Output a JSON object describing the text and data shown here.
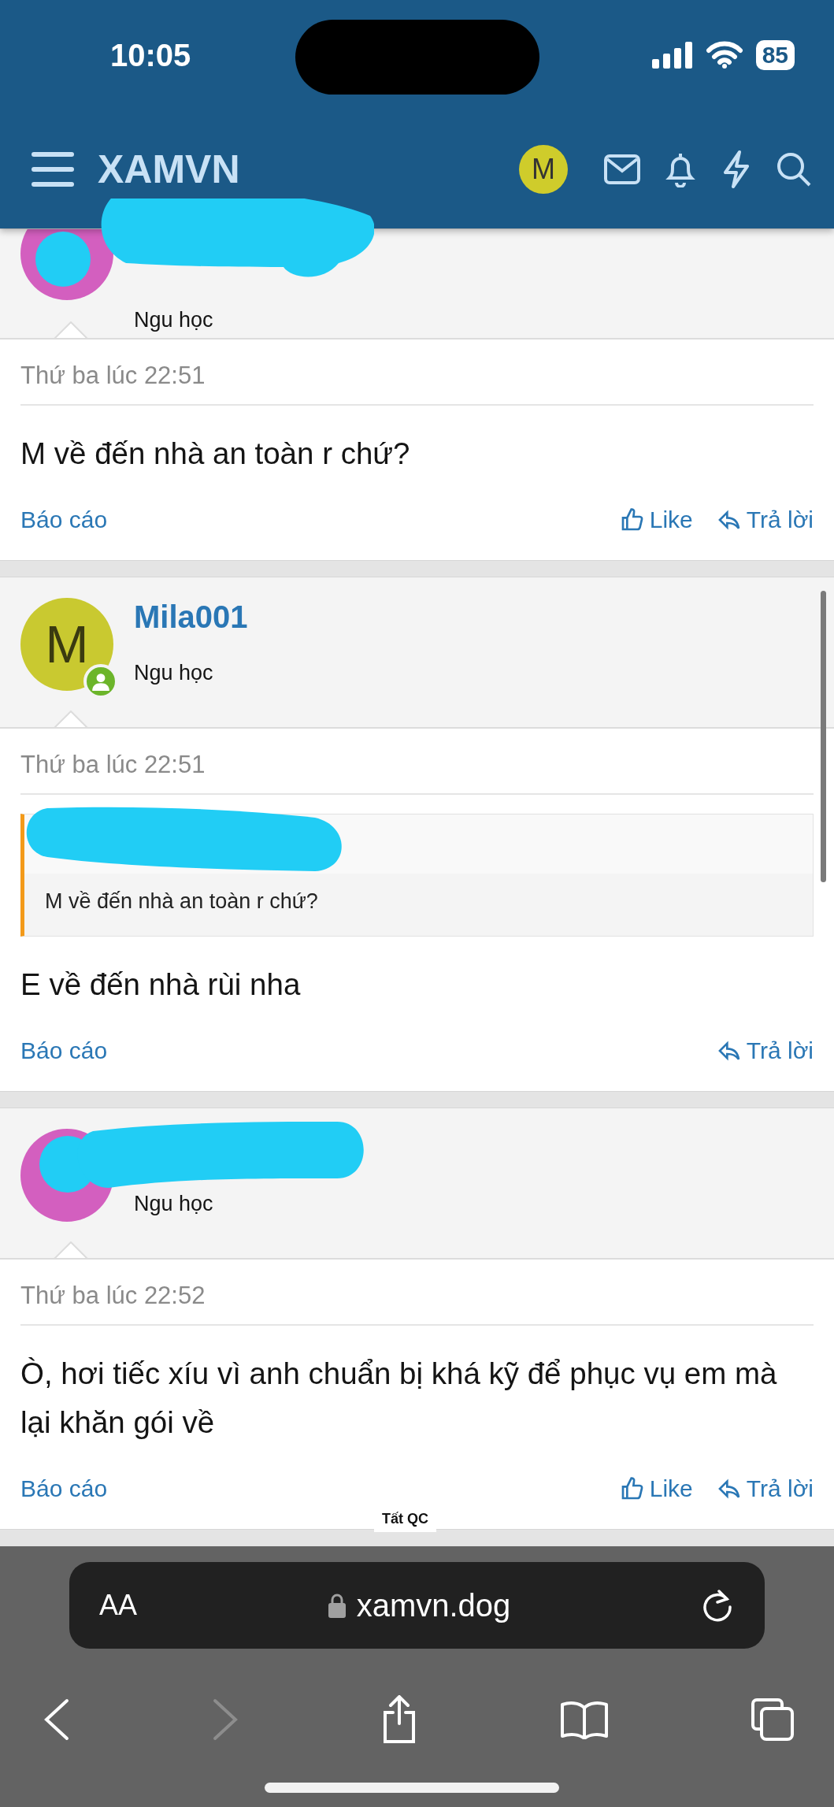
{
  "status_bar": {
    "time": "10:05",
    "battery": "85"
  },
  "header": {
    "title": "XAMVN",
    "account_letter": "M"
  },
  "posts": [
    {
      "kind": "cut",
      "color": "#d35fbf",
      "online": false,
      "user_title": "Ngu học",
      "time": "Thứ ba lúc 22:51",
      "message": "M về đến nhà an toàn r chứ?",
      "report": "Báo cáo",
      "like": "Like",
      "reply": "Trả lời"
    },
    {
      "kind": "full",
      "username": "Mila001",
      "avatar_letter": "M",
      "color": "#c9c930",
      "online": true,
      "user_title": "Ngu học",
      "time": "Thứ ba lúc 22:51",
      "quote": "M về đến nhà an toàn r chứ?",
      "message": "E về đến nhà rùi nha",
      "report": "Báo cáo",
      "reply": "Trả lời"
    },
    {
      "kind": "full",
      "color": "#d35fbf",
      "online": false,
      "user_title": "Ngu học",
      "time": "Thứ ba lúc 22:52",
      "message": "Ò, hơi tiếc xíu vì anh chuẩn bị khá kỹ để phục vụ em mà lại khăn gói về",
      "report": "Báo cáo",
      "like": "Like",
      "reply": "Trả lời"
    }
  ],
  "ad_toggle": "Tất QC",
  "browser": {
    "text_size": "AA",
    "url": "xamvn.dog",
    "forward_disabled": true
  }
}
